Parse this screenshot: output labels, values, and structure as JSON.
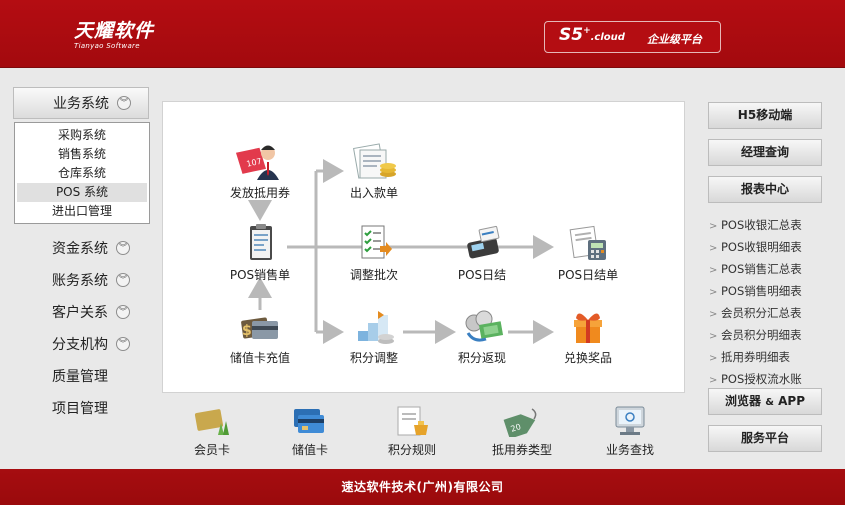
{
  "header": {
    "logo_cn": "天耀软件",
    "logo_en": "Tianyao Software",
    "cloud_logo_main": "S5",
    "cloud_logo_sup": "+",
    "cloud_logo_suffix": ".cloud",
    "cloud_tagline": "企业级平台"
  },
  "sidebar": {
    "head_label": "业务系统",
    "submenu": [
      {
        "label": "采购系统"
      },
      {
        "label": "销售系统"
      },
      {
        "label": "仓库系统"
      },
      {
        "label": "POS 系统",
        "active": true
      },
      {
        "label": "进出口管理"
      }
    ],
    "items": [
      {
        "label": "资金系统",
        "expandable": true
      },
      {
        "label": "账务系统",
        "expandable": true
      },
      {
        "label": "客户关系",
        "expandable": true
      },
      {
        "label": "分支机构",
        "expandable": true
      },
      {
        "label": "质量管理",
        "expandable": false
      },
      {
        "label": "项目管理",
        "expandable": false
      }
    ]
  },
  "flow": {
    "coupon_issue": "发放抵用券",
    "pos_sales": "POS销售单",
    "stored_card_recharge": "储值卡充值",
    "io_voucher": "出入款单",
    "adjust_batch": "调整批次",
    "points_adjust": "积分调整",
    "pos_daily": "POS日结",
    "points_return": "积分返现",
    "pos_daily_sheet": "POS日结单",
    "redeem_prize": "兑换奖品"
  },
  "bottom": {
    "member_card": "会员卡",
    "stored_card": "储值卡",
    "points_rules": "积分规则",
    "coupon_types": "抵用券类型",
    "business_lookup": "业务查找"
  },
  "right": {
    "h5_mobile": "H5移动端",
    "manager_query": "经理查询",
    "report_center": "报表中心",
    "reports": [
      "POS收银汇总表",
      "POS收银明细表",
      "POS销售汇总表",
      "POS销售明细表",
      "会员积分汇总表",
      "会员积分明细表",
      "抵用券明细表",
      "POS授权流水账"
    ],
    "browser_app_a": "浏览器",
    "browser_app_b": "&",
    "browser_app_c": "APP",
    "service_platform": "服务平台"
  },
  "footer": {
    "company": "速达软件技术(广州)有限公司"
  },
  "colors": {
    "brand_red": "#b40d12",
    "footer_red": "#a60d10",
    "page_bg": "#e9e9e9",
    "arrow_gray": "#b9b9b9"
  }
}
